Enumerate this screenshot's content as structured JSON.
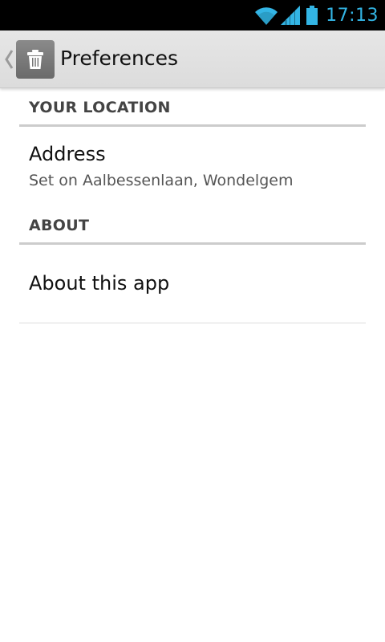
{
  "status_bar": {
    "time": "17:13",
    "icons": [
      "wifi-icon",
      "signal-icon",
      "battery-icon"
    ],
    "accent_color": "#33b5e5"
  },
  "action_bar": {
    "title": "Preferences",
    "app_icon": "trash-icon",
    "up_icon": "chevron-left-icon"
  },
  "preferences": {
    "location_category": "YOUR LOCATION",
    "address_title": "Address",
    "address_summary": "Set on Aalbessenlaan, Wondelgem",
    "about_category": "ABOUT",
    "about_title": "About this app"
  }
}
